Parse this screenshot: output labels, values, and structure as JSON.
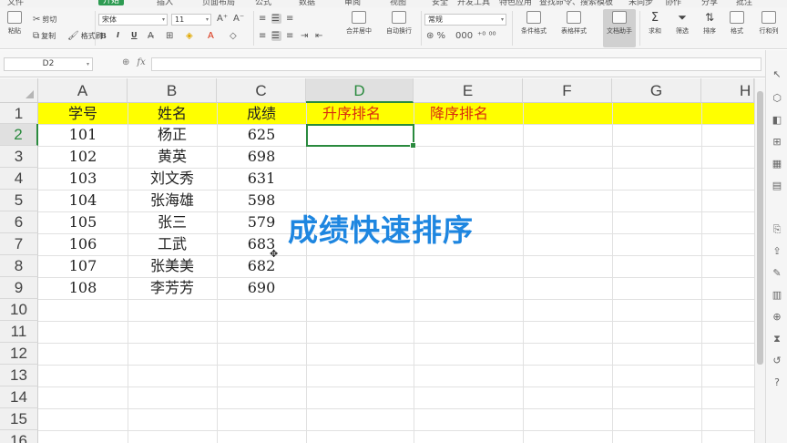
{
  "menubar": {
    "items": [
      "文件",
      "开始",
      "插入",
      "页面布局",
      "公式",
      "数据",
      "审阅",
      "视图",
      "安全",
      "开发工具",
      "特色应用",
      "查找命令、搜索模板",
      "未同步",
      "协作",
      "分享",
      "批注"
    ]
  },
  "ribbon": {
    "paste": "粘贴",
    "cut": "剪切",
    "copy": "复制",
    "format_painter": "格式刷",
    "font_name": "宋体",
    "font_size": "11",
    "bold": "B",
    "italic": "I",
    "underline": "U",
    "merge_center": "合并居中",
    "wrap_text": "自动换行",
    "number_format": "常规",
    "conditional_format": "条件格式",
    "table_style": "表格样式",
    "doc_assistant": "文档助手",
    "sum": "求和",
    "filter": "筛选",
    "sort": "排序",
    "format": "格式",
    "row_col": "行和列",
    "icons": [
      "cut-icon",
      "copy-icon",
      "format-painter-icon",
      "font-grow-icon",
      "font-shrink-icon",
      "border-icon",
      "fill-color-icon",
      "font-color-icon",
      "eraser-icon",
      "align-icon",
      "percent-icon",
      "sum-icon",
      "filter-icon",
      "sort-icon"
    ]
  },
  "formula_bar": {
    "name_box": "D2",
    "fx_label": "fx",
    "value": ""
  },
  "sheet": {
    "columns": [
      "A",
      "B",
      "C",
      "D",
      "E",
      "F",
      "G",
      "H"
    ],
    "rows": [
      "1",
      "2",
      "3",
      "4",
      "5",
      "6",
      "7",
      "8",
      "9",
      "10",
      "11",
      "12",
      "13",
      "14",
      "15",
      "16"
    ],
    "active_cell": "D2",
    "header": {
      "a": "学号",
      "b": "姓名",
      "c": "成绩",
      "d": "升序排名",
      "e": "降序排名"
    },
    "data": [
      {
        "id": "101",
        "name": "杨正",
        "score": "625"
      },
      {
        "id": "102",
        "name": "黄英",
        "score": "698"
      },
      {
        "id": "103",
        "name": "刘文秀",
        "score": "631"
      },
      {
        "id": "104",
        "name": "张海雄",
        "score": "598"
      },
      {
        "id": "105",
        "name": "张三",
        "score": "579"
      },
      {
        "id": "106",
        "name": "工武",
        "score": "683"
      },
      {
        "id": "107",
        "name": "张美美",
        "score": "682"
      },
      {
        "id": "108",
        "name": "李芳芳",
        "score": "690"
      }
    ],
    "header_fill": "#ffff00",
    "header_red": "#d92e10",
    "accent": "#2a8a3e"
  },
  "overlay_title": "成绩快速排序",
  "overlay_color": "#1e86e0"
}
